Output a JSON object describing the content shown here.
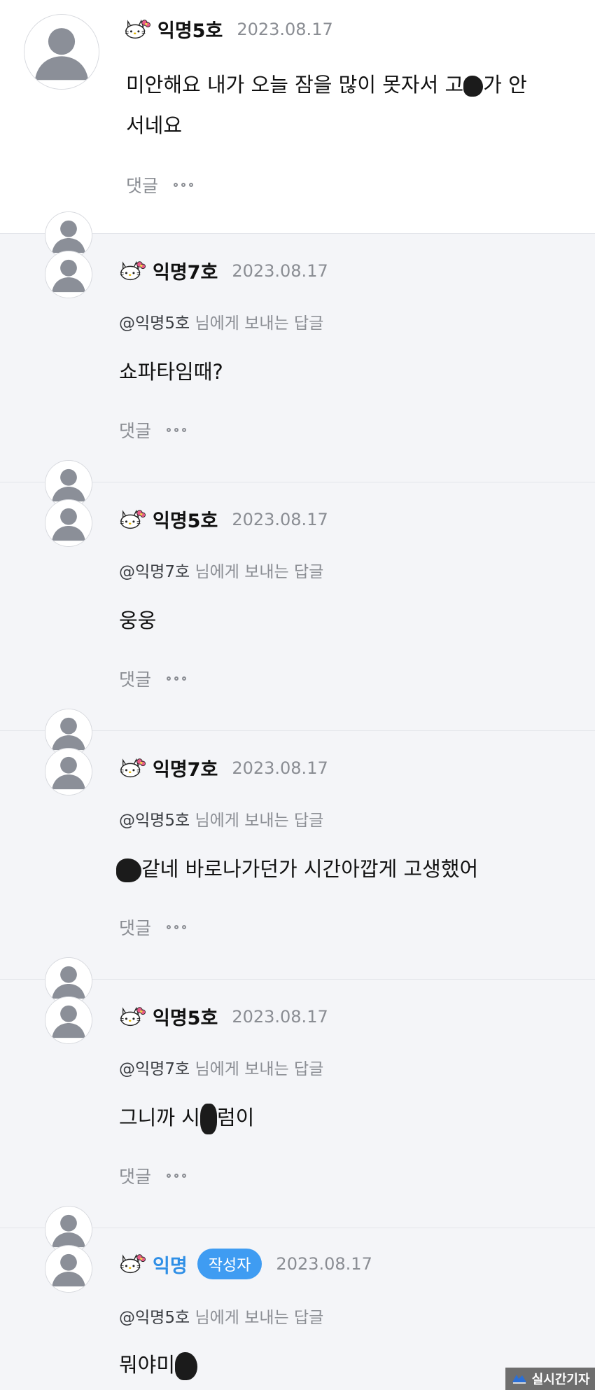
{
  "comments": [
    {
      "author": "익명5호",
      "date": "2023.08.17",
      "text_line1_a": "미안해요 내가 오늘 잠을 많이 못자서 고",
      "text_line1_b": "가 안",
      "text_line2": "서네요",
      "reply_label": "댓글"
    },
    {
      "author": "익명7호",
      "date": "2023.08.17",
      "mention_to": "@익명5호",
      "mention_rest": "님에게 보내는 답글",
      "text": "쇼파타임때?",
      "reply_label": "댓글"
    },
    {
      "author": "익명5호",
      "date": "2023.08.17",
      "mention_to": "@익명7호",
      "mention_rest": "님에게 보내는 답글",
      "text": "웅웅",
      "reply_label": "댓글"
    },
    {
      "author": "익명7호",
      "date": "2023.08.17",
      "mention_to": "@익명5호",
      "mention_rest": "님에게 보내는 답글",
      "text_a": "같네 바로나가던가 시간아깝게 고생했어",
      "reply_label": "댓글"
    },
    {
      "author": "익명5호",
      "date": "2023.08.17",
      "mention_to": "@익명7호",
      "mention_rest": "님에게 보내는 답글",
      "text_a": "그니까 시",
      "text_b": "럼이",
      "reply_label": "댓글"
    },
    {
      "author": "익명",
      "badge": "작성자",
      "date": "2023.08.17",
      "mention_to": "@익명5호",
      "mention_rest": "님에게 보내는 답글",
      "text_a": "뭐야미"
    }
  ],
  "watermark": "실시간기자",
  "icons": {
    "avatar": "default-profile-icon",
    "author_icon": "hello-kitty-icon",
    "more": "more-dots-icon",
    "censor": "censor-blot"
  },
  "colors": {
    "author_highlight": "#2f8fe6",
    "badge_bg": "#3f9cf2",
    "reply_bg": "#f4f5f8",
    "top_bg": "#ffffff",
    "meta_gray": "#8a8d93"
  }
}
